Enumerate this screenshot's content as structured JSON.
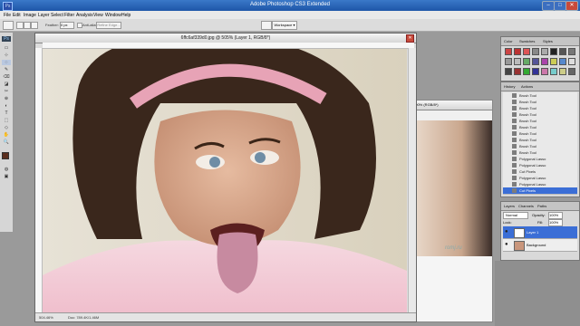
{
  "window": {
    "title": "Adobe Photoshop CS3 Extended",
    "app_badge": "Ps",
    "controls": [
      "–",
      "□",
      "✕"
    ]
  },
  "menu": [
    "File",
    "Edit",
    "Image",
    "Layer",
    "Select",
    "Filter",
    "Analysis",
    "View",
    "Window",
    "Help"
  ],
  "options_bar": {
    "feather_label": "Feather:",
    "feather_value": "0 px",
    "anti_alias": "Anti-alias",
    "refine_edge": "Refine Edge...",
    "workspace": "Workspace ▾"
  },
  "document": {
    "title": "6ffc6af339d0.jpg @ 505% (Layer 1, RGB/8*)",
    "zoom": "504.46%",
    "doc_info": "Doc: 789.4K/1.46M"
  },
  "background_document": {
    "title": "100% (RGB/8*)",
    "watermark": "romj.ru"
  },
  "color_panel": {
    "tabs": [
      "Color",
      "Swatches",
      "Styles"
    ],
    "colors": [
      "#c44",
      "#b33",
      "#d55",
      "#888",
      "#aaa",
      "#222",
      "#555",
      "#777",
      "#999",
      "#bbb",
      "#6a6",
      "#559",
      "#a4a",
      "#cc5",
      "#58c",
      "#ddd",
      "#444",
      "#933",
      "#3a3",
      "#339",
      "#c7a",
      "#7cc",
      "#cc8",
      "#666"
    ]
  },
  "history_panel": {
    "tabs": [
      "History",
      "Actions"
    ],
    "items": [
      "Brush Tool",
      "Brush Tool",
      "Brush Tool",
      "Brush Tool",
      "Brush Tool",
      "Brush Tool",
      "Brush Tool",
      "Brush Tool",
      "Brush Tool",
      "Brush Tool",
      "Polygonal Lasso",
      "Polygonal Lasso",
      "Cut Pixels",
      "Polygonal Lasso",
      "Polygonal Lasso",
      "Cut Pixels"
    ],
    "selected_index": 15
  },
  "layers_panel": {
    "tabs": [
      "Layers",
      "Channels",
      "Paths"
    ],
    "blend_mode": "Normal",
    "opacity_label": "Opacity:",
    "opacity_value": "100%",
    "lock_label": "Lock:",
    "fill_label": "Fill:",
    "fill_value": "100%",
    "layers": [
      "Layer 1",
      "Background"
    ],
    "selected_index": 0
  },
  "tools": [
    "▭",
    "⊹",
    "✎",
    "⌫",
    "◪",
    "✂",
    "⊕",
    "◐",
    "T",
    "⬚",
    "◇",
    "✋",
    "🔍"
  ],
  "accent_color": "#3b6ed6"
}
